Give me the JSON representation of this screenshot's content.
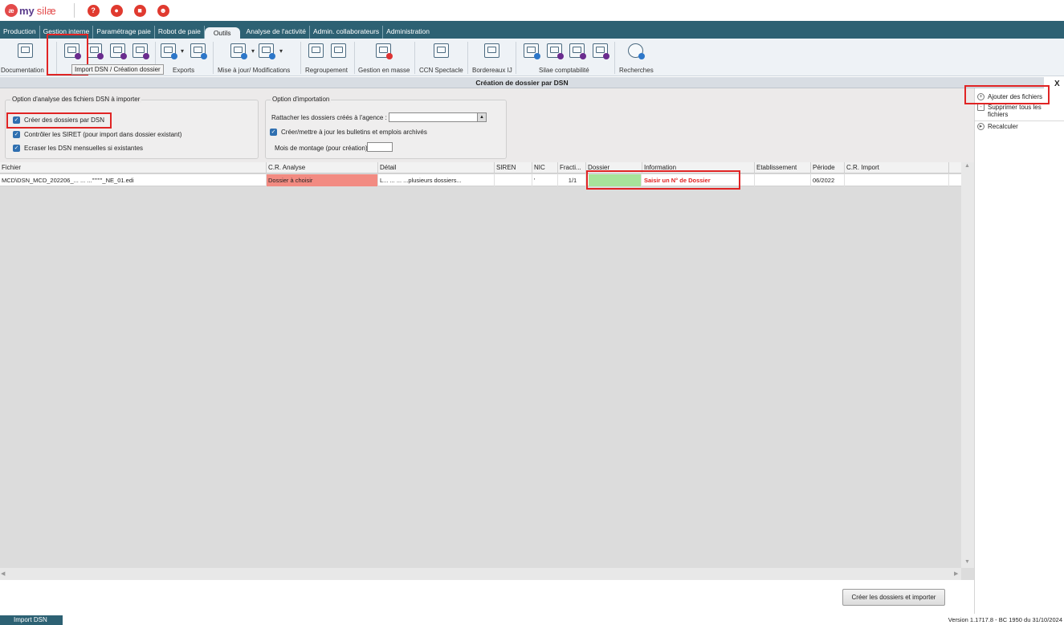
{
  "app": {
    "logo_initials": "æ",
    "logo_my": "my",
    "logo_silae": "silæ",
    "top_icons": [
      "help-icon",
      "chat-icon",
      "calendar-icon",
      "user-icon"
    ]
  },
  "menu": {
    "items": [
      {
        "label": "Production"
      },
      {
        "label": "Gestion interne"
      },
      {
        "label": "Paramétrage paie"
      },
      {
        "label": "Robot de paie"
      },
      {
        "label": "Outils",
        "active": true
      },
      {
        "label": "Analyse de l'activité"
      },
      {
        "label": "Admin. collaborateurs"
      },
      {
        "label": "Administration"
      }
    ]
  },
  "toolbar": {
    "labels": {
      "documentation": "Documentation",
      "exports": "Exports",
      "mise_a_jour": "Mise à jour/ Modifications",
      "regroupement": "Regroupement",
      "gestion_masse": "Gestion en masse",
      "ccn_spectacle": "CCN Spectacle",
      "bordereaux": "Bordereaux IJ",
      "silae_compta": "Silae comptabilité",
      "recherches": "Recherches"
    },
    "tooltip": "Import DSN / Création dossier"
  },
  "panel": {
    "title": "Création de dossier par DSN",
    "close": "X"
  },
  "options": {
    "analysis_title": "Option d'analyse des fichiers DSN à importer",
    "creer_dossiers": "Créer des dossiers par DSN",
    "controler_siret": "Contrôler les SIRET (pour import dans dossier existant)",
    "ecraser_dsn": "Ecraser les DSN mensuelles si existantes",
    "import_title": "Option d'importation",
    "rattacher": "Rattacher les dossiers créés à l'agence :",
    "creer_bulletins": "Créer/mettre à jour les bulletins et emplois archivés",
    "mois_montage": "Mois de montage (pour création) :"
  },
  "grid": {
    "headers": {
      "fichier": "Fichier",
      "cr_analyse": "C.R. Analyse",
      "detail": "Détail",
      "siren": "SIREN",
      "nic": "NIC",
      "fraction": "Fracti...",
      "dossier": "Dossier",
      "information": "Information",
      "etablissement": "Etablissement",
      "periode": "Période",
      "cr_import": "C.R. Import"
    },
    "rows": [
      {
        "fichier": "MCD\\DSN_MCD_202206_... ...  ...'''''''''_NE_01.edi",
        "cr_analyse": "Dossier à choisir",
        "detail": "L...   ...   ...   ...plusieurs dossiers...",
        "siren": "",
        "nic": "'",
        "fraction": "1/1",
        "dossier": "",
        "information": "Saisir un N° de Dossier",
        "etablissement": "",
        "periode": "06/2022",
        "cr_import": ""
      }
    ]
  },
  "actions": {
    "create_import": "Créer les dossiers et importer"
  },
  "right_panel": {
    "ajouter": "Ajouter des fichiers",
    "supprimer": "Supprimer tous les fichiers",
    "recalculer": "Recalculer"
  },
  "footer": {
    "tab": "Import DSN",
    "version": "Version 1.1717.8 - BC 1950 du 31/10/2024"
  },
  "colors": {
    "menubar": "#2d6173",
    "highlight": "#e02424",
    "cr_analyse_bg": "#f28b82",
    "dossier_bg": "#a7e39a"
  }
}
